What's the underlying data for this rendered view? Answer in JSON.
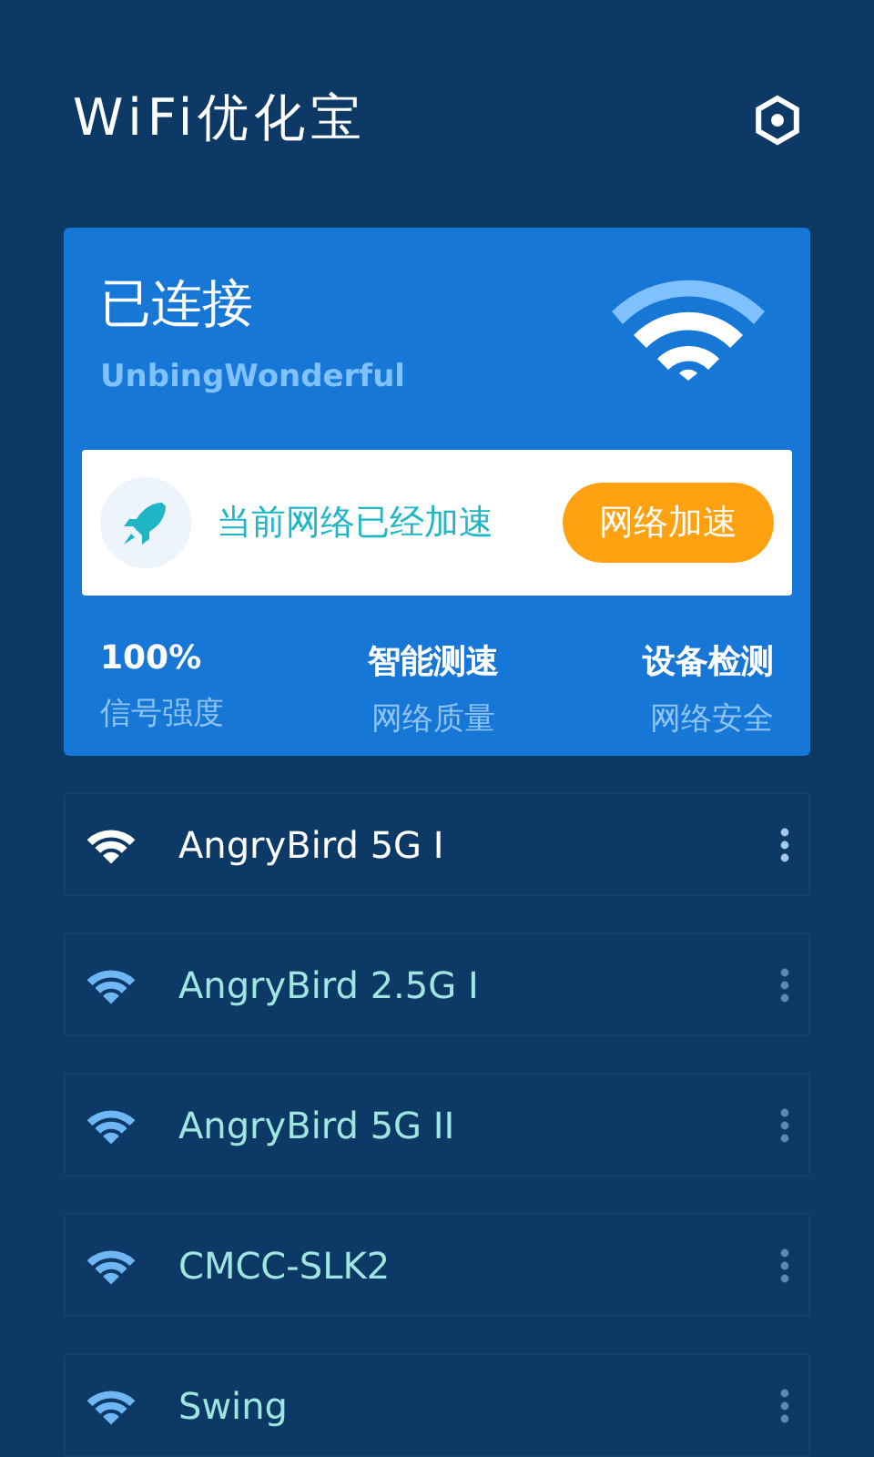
{
  "app_bar": {
    "title": "WiFi优化宝"
  },
  "connection_card": {
    "status": "已连接",
    "ssid": "UnbingWonderful",
    "boost_message": "当前网络已经加速",
    "boost_button": "网络加速",
    "stats": [
      {
        "value": "100%",
        "label": "信号强度"
      },
      {
        "value": "智能测速",
        "label": "网络质量"
      },
      {
        "value": "设备检测",
        "label": "网络安全"
      }
    ]
  },
  "networks": [
    {
      "name": "AngryBird 5G I",
      "selected": true
    },
    {
      "name": "AngryBird 2.5G I",
      "selected": false
    },
    {
      "name": "AngryBird 5G II",
      "selected": false
    },
    {
      "name": "CMCC-SLK2",
      "selected": false
    },
    {
      "name": "Swing",
      "selected": false
    }
  ]
}
